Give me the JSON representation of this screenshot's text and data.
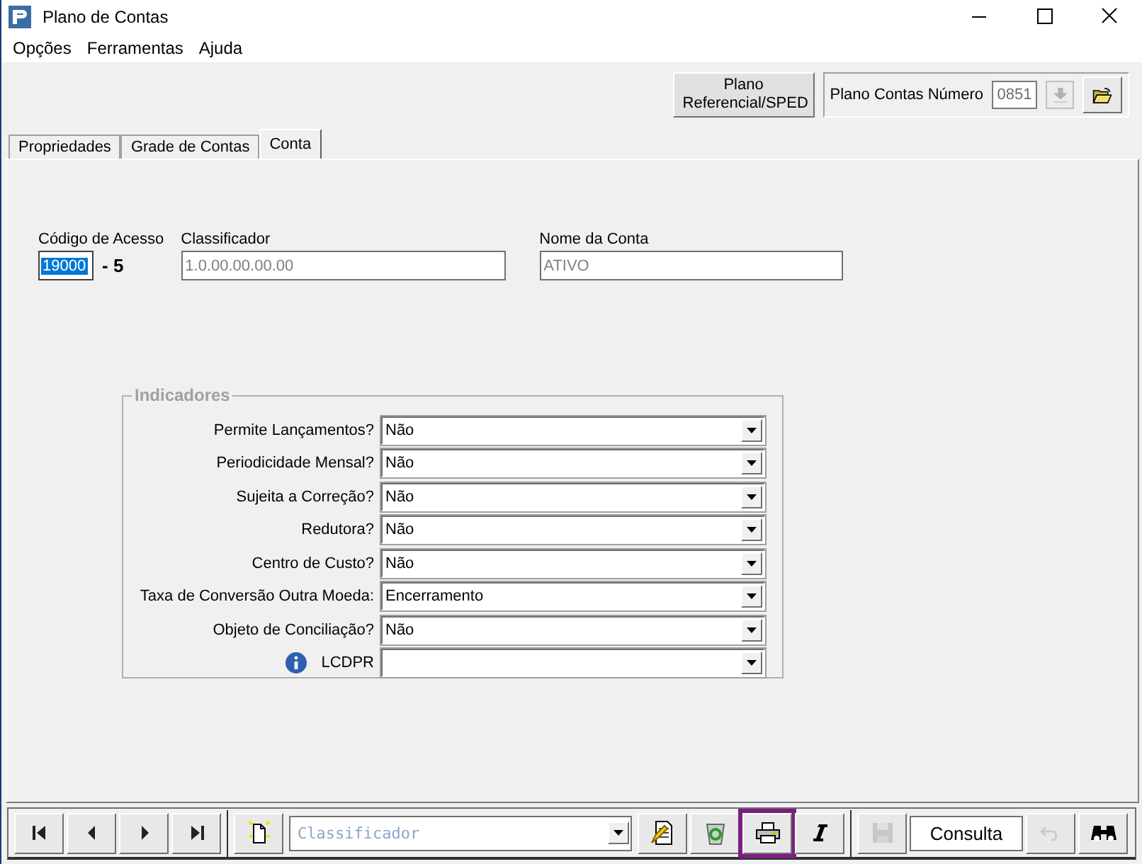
{
  "window": {
    "title": "Plano de Contas"
  },
  "menu": [
    "Opções",
    "Ferramentas",
    "Ajuda"
  ],
  "header": {
    "sped_button": "Plano Referencial/SPED",
    "plan_label": "Plano Contas Número",
    "plan_value": "0851"
  },
  "tabs": [
    {
      "label": "Propriedades",
      "selected": false
    },
    {
      "label": "Grade de Contas",
      "selected": false
    },
    {
      "label": "Conta",
      "selected": true
    }
  ],
  "account": {
    "code_label": "Código de Acesso",
    "code_value": "19000",
    "code_selected": true,
    "check_digit": "- 5",
    "classifier_label": "Classificador",
    "classifier_value": "1.0.00.00.00.00",
    "name_label": "Nome da Conta",
    "name_value": "ATIVO"
  },
  "indicators": {
    "title": "Indicadores",
    "rows": [
      {
        "label": "Permite Lançamentos?",
        "value": "Não",
        "info": false
      },
      {
        "label": "Periodicidade Mensal?",
        "value": "Não",
        "info": false
      },
      {
        "label": "Sujeita a Correção?",
        "value": "Não",
        "info": false
      },
      {
        "label": "Redutora?",
        "value": "Não",
        "info": false
      },
      {
        "label": "Centro de Custo?",
        "value": "Não",
        "info": false
      },
      {
        "label": "Taxa de Conversão Outra Moeda:",
        "value": "Encerramento",
        "info": false
      },
      {
        "label": "Objeto de Conciliação?",
        "value": "Não",
        "info": false
      },
      {
        "label": "LCDPR",
        "info": true
      }
    ]
  },
  "toolbar": {
    "classifier_placeholder": "Classificador",
    "mode": "Consulta",
    "buttons": [
      {
        "kind": "first",
        "disabled": false,
        "selected": false
      },
      {
        "kind": "prev",
        "disabled": false,
        "selected": false
      },
      {
        "kind": "next",
        "disabled": false,
        "selected": false
      },
      {
        "kind": "last",
        "disabled": false,
        "selected": false
      },
      {
        "kind": "new",
        "disabled": false,
        "selected": false
      },
      {
        "kind": "combo"
      },
      {
        "kind": "edit",
        "disabled": false,
        "selected": false
      },
      {
        "kind": "recycle",
        "disabled": false,
        "selected": false
      },
      {
        "kind": "print",
        "disabled": false,
        "selected": true
      },
      {
        "kind": "italic",
        "disabled": false,
        "selected": false
      },
      {
        "kind": "save",
        "disabled": true,
        "selected": false
      },
      {
        "kind": "mode"
      },
      {
        "kind": "undo",
        "disabled": true,
        "selected": false
      },
      {
        "kind": "find",
        "disabled": false,
        "selected": false
      }
    ]
  }
}
